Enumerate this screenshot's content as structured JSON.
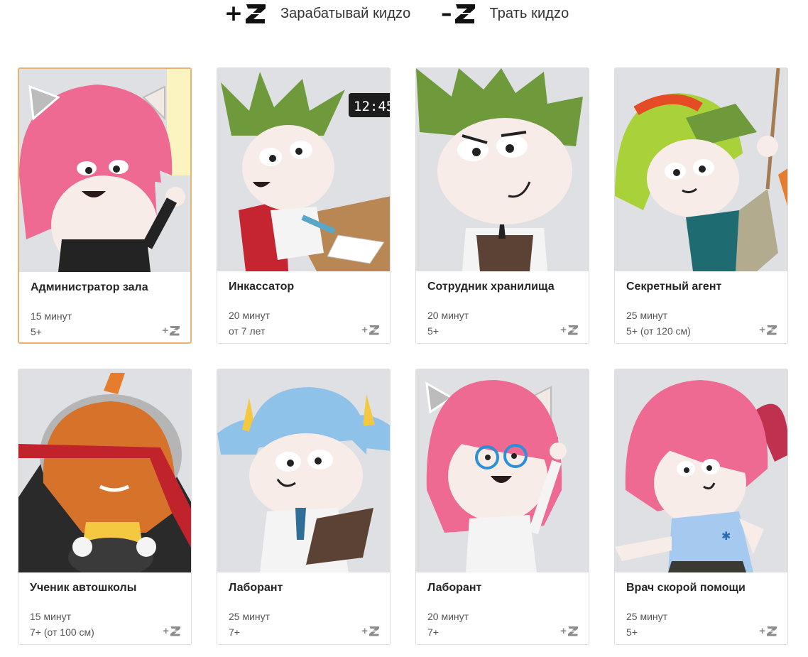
{
  "legend": {
    "earn_sign": "+",
    "earn_label": "Зарабатывай кидzo",
    "spend_sign": "–",
    "spend_label": "Трать кидzo"
  },
  "colors": {
    "active_border": "#e9b371",
    "card_border": "#dedede",
    "art_background": "#dfe0e4"
  },
  "cards": [
    {
      "title": "Администратор зала",
      "duration": "15 минут",
      "age": "5+",
      "reward_sign": "+",
      "reward_icon": "kidzo-coin-icon"
    },
    {
      "title": "Инкассатор",
      "duration": "20 минут",
      "age": "от 7 лет",
      "reward_sign": "+",
      "reward_icon": "kidzo-coin-icon"
    },
    {
      "title": "Сотрудник хранилища",
      "duration": "20 минут",
      "age": "5+",
      "reward_sign": "+",
      "reward_icon": "kidzo-coin-icon"
    },
    {
      "title": "Секретный агент",
      "duration": "25 минут",
      "age": "5+ (от 120 см)",
      "reward_sign": "+",
      "reward_icon": "kidzo-coin-icon"
    },
    {
      "title": "Ученик автошколы",
      "duration": "15 минут",
      "age": "7+ (от 100 см)",
      "reward_sign": "+",
      "reward_icon": "kidzo-coin-icon"
    },
    {
      "title": "Лаборант",
      "duration": "25 минут",
      "age": "7+",
      "reward_sign": "+",
      "reward_icon": "kidzo-coin-icon"
    },
    {
      "title": "Лаборант",
      "duration": "20 минут",
      "age": "7+",
      "reward_sign": "+",
      "reward_icon": "kidzo-coin-icon"
    },
    {
      "title": "Врач скорой помощи",
      "duration": "25 минут",
      "age": "5+",
      "reward_sign": "+",
      "reward_icon": "kidzo-coin-icon"
    }
  ],
  "illustrations": {
    "clock_readout": "12:45"
  }
}
